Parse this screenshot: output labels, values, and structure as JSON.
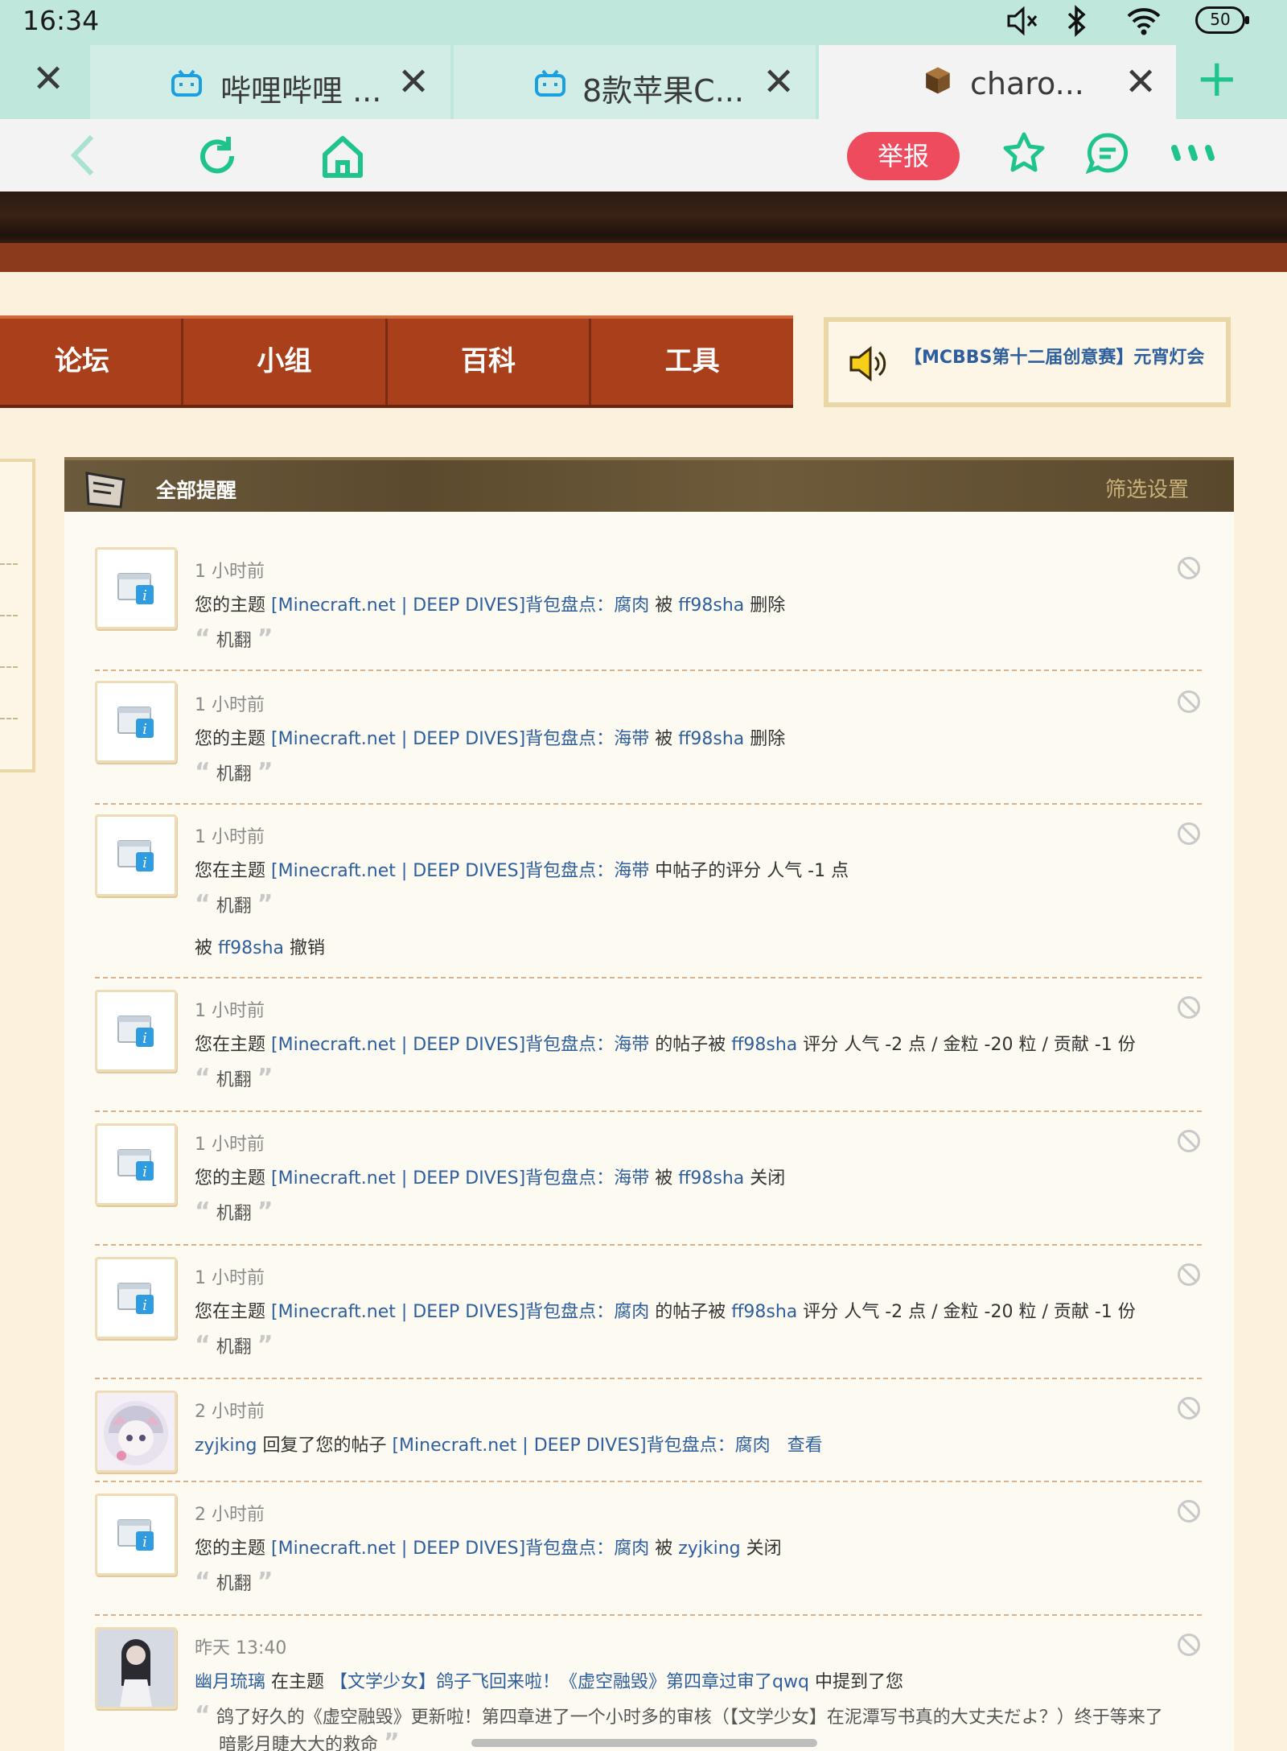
{
  "status_bar": {
    "time": "16:34",
    "battery": "50"
  },
  "tabs": [
    {
      "label": "哔哩哔哩 ...",
      "icon": "bilibili-icon"
    },
    {
      "label": "8款苹果C...",
      "icon": "bilibili-icon"
    },
    {
      "label": "charo...",
      "icon": "minecraft-block-icon"
    }
  ],
  "toolbar": {
    "report_label": "举报"
  },
  "nav": {
    "items": [
      "论坛",
      "小组",
      "百科",
      "工具"
    ]
  },
  "notice": {
    "text": "【MCBBS第十二届创意赛】元宵灯会"
  },
  "panel": {
    "title": "全部提醒",
    "filter": "筛选设置"
  },
  "notifications": [
    {
      "time": "1 小时前",
      "p1": "您的主题 ",
      "topic": "[Minecraft.net | DEEP DIVES]背包盘点：",
      "item": "腐肉",
      "p2": " 被 ",
      "user": "ff98sha",
      "p3": " 删除",
      "quote": "机翻"
    },
    {
      "time": "1 小时前",
      "p1": "您的主题 ",
      "topic": "[Minecraft.net | DEEP DIVES]背包盘点：",
      "item": "海带",
      "p2": " 被 ",
      "user": "ff98sha",
      "p3": " 删除",
      "quote": "机翻"
    },
    {
      "time": "1 小时前",
      "p1": "您在主题 ",
      "topic": "[Minecraft.net | DEEP DIVES]背包盘点：",
      "item": "海带",
      "p2": " 中帖子的评分 人气 -1 点",
      "quote": "机翻",
      "extra1": "被 ",
      "extra_user": "ff98sha",
      "extra2": " 撤销"
    },
    {
      "time": "1 小时前",
      "p1": "您在主题 ",
      "topic": "[Minecraft.net | DEEP DIVES]背包盘点：",
      "item": "海带",
      "p2": " 的帖子被 ",
      "user": "ff98sha",
      "p3": " 评分 人气 -2 点 / 金粒 -20 粒 / 贡献 -1 份",
      "quote": "机翻"
    },
    {
      "time": "1 小时前",
      "p1": "您的主题 ",
      "topic": "[Minecraft.net | DEEP DIVES]背包盘点：",
      "item": "海带",
      "p2": " 被 ",
      "user": "ff98sha",
      "p3": " 关闭",
      "quote": "机翻"
    },
    {
      "time": "1 小时前",
      "p1": "您在主题 ",
      "topic": "[Minecraft.net | DEEP DIVES]背包盘点：",
      "item": "腐肉",
      "p2": " 的帖子被 ",
      "user": "ff98sha",
      "p3": " 评分 人气 -2 点 / 金粒 -20 粒 / 贡献 -1 份",
      "quote": "机翻"
    },
    {
      "time": "2 小时前",
      "user": "zyjking",
      "p1": " 回复了您的帖子 ",
      "topic": "[Minecraft.net | DEEP DIVES]背包盘点：",
      "item": "腐肉",
      "view": "查看"
    },
    {
      "time": "2 小时前",
      "p1": "您的主题 ",
      "topic": "[Minecraft.net | DEEP DIVES]背包盘点：",
      "item": "腐肉",
      "p2": " 被 ",
      "user": "zyjking",
      "p3": " 关闭",
      "quote": "机翻"
    },
    {
      "time": "昨天 13:40",
      "user": "幽月琉璃",
      "p1": " 在主题 ",
      "topic": "【文学少女】鸽子飞回来啦！《虚空融毁》第四章过审了qwq",
      "p2": " 中提到了您",
      "quote": "鸽了好久的《虚空融毁》更新啦！第四章进了一个小时多的审核（【文学少女】在泥潭写书真的大丈夫だよ？）终于等来了",
      "quote2": "暗影月睫大大的救命"
    }
  ]
}
